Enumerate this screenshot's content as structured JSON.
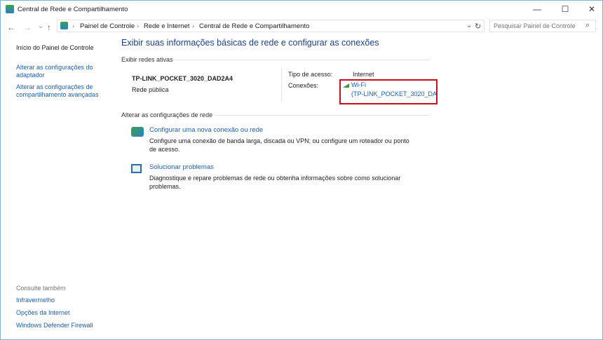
{
  "window": {
    "title": "Central de Rede e Compartilhamento",
    "minimize": "—",
    "maximize": "☐",
    "close": "✕"
  },
  "nav": {
    "back": "←",
    "forward": "→",
    "recent": "⌄",
    "up": "↑",
    "refresh": "↻",
    "dropdown": "⌄",
    "breadcrumbs": [
      "Painel de Controle",
      "Rede e Internet",
      "Central de Rede e Compartilhamento"
    ],
    "sep": "›"
  },
  "search": {
    "placeholder": "Pesquisar Painel de Controle",
    "icon": "⌕"
  },
  "sidebar": {
    "items": [
      "Início do Painel de Controle",
      "Alterar as configurações do adaptador",
      "Alterar as configurações de compartilhamento avançadas"
    ],
    "see_also_title": "Consulte também",
    "see_also": [
      "Infravermelho",
      "Opções da Internet",
      "Windows Defender Firewall"
    ]
  },
  "main": {
    "heading": "Exibir suas informações básicas de rede e configurar as conexões",
    "active_title": "Exibir redes ativas",
    "network_name": "TP-LINK_POCKET_3020_DAD2A4",
    "network_type": "Rede pública",
    "access_label": "Tipo de acesso:",
    "access_value": "Internet",
    "conn_label": "Conexões:",
    "conn_line1": "Wi-Fi",
    "conn_line2": "(TP-LINK_POCKET_3020_DA",
    "change_title": "Alterar as configurações de rede",
    "tasks": [
      {
        "title": "Configurar uma nova conexão ou rede",
        "desc": "Configure uma conexão de banda larga, discada ou VPN; ou configure um roteador ou ponto de acesso."
      },
      {
        "title": "Solucionar problemas",
        "desc": "Diagnostique e repare problemas de rede ou obtenha informações sobre como solucionar problemas."
      }
    ]
  },
  "colors": {
    "accent": "#1c5fa8",
    "highlight": "#c8101a",
    "heading": "#1e3f8a"
  }
}
